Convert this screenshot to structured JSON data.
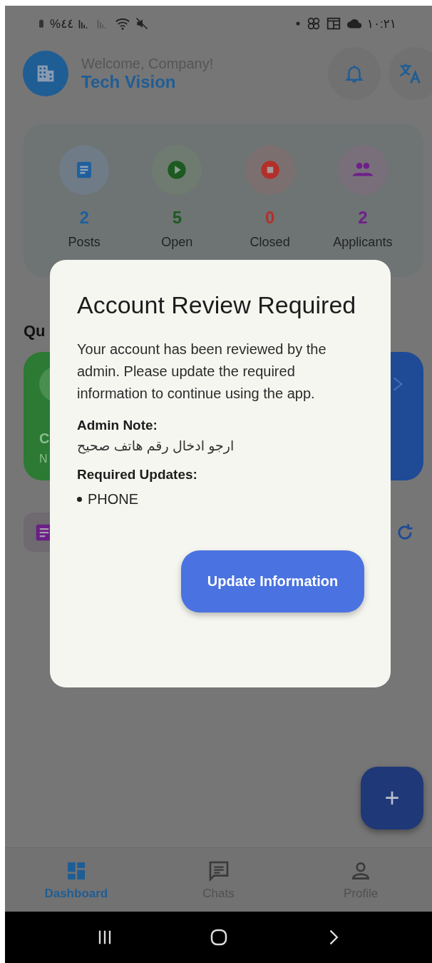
{
  "status_bar": {
    "battery": "%٤٤",
    "time": "١٠:٢١"
  },
  "header": {
    "greeting": "Welcome, Company!",
    "company": "Tech Vision"
  },
  "stats": [
    {
      "kind": "posts",
      "value": "2",
      "label": "Posts",
      "color": "#1f5f9e"
    },
    {
      "kind": "open",
      "value": "5",
      "label": "Open",
      "color": "#1d5a21"
    },
    {
      "kind": "closed",
      "value": "0",
      "label": "Closed",
      "color": "#b3302a"
    },
    {
      "kind": "applicants",
      "value": "2",
      "label": "Applicants",
      "color": "#6e1f8a"
    }
  ],
  "quick": {
    "heading": "Qu",
    "cards": [
      {
        "kind": "green",
        "title": "C",
        "subtitle": "N"
      },
      {
        "kind": "blue"
      }
    ]
  },
  "dialog": {
    "title": "Account Review Required",
    "message": "Your account has been reviewed by the admin. Please update the required information to continue using the app.",
    "note_label": "Admin Note:",
    "note": "ارجو ادخال رقم هاتف صحيح",
    "updates_label": "Required Updates:",
    "updates": [
      "PHONE"
    ],
    "button": "Update Information"
  },
  "fab": {
    "label": "+"
  },
  "nav": [
    {
      "kind": "dashboard",
      "label": "Dashboard",
      "selected": true
    },
    {
      "kind": "chats",
      "label": "Chats",
      "selected": false
    },
    {
      "kind": "profile",
      "label": "Profile",
      "selected": false
    }
  ]
}
